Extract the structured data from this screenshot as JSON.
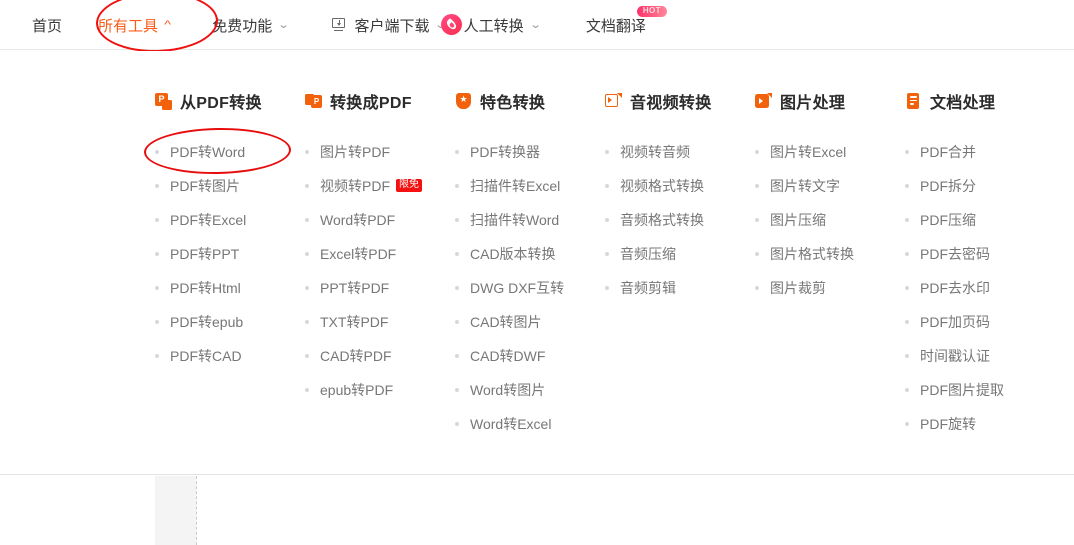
{
  "topnav": {
    "items": [
      {
        "label": "首页",
        "icon": null,
        "caret": null,
        "active": false,
        "badge": null
      },
      {
        "label": "所有工具",
        "icon": null,
        "caret": "^",
        "active": true,
        "badge": null
      },
      {
        "label": "免费功能",
        "icon": null,
        "caret": "⌄",
        "active": false,
        "badge": null
      },
      {
        "label": "客户端下载",
        "icon": "download-monitor-icon",
        "caret": "⌄",
        "active": false,
        "badge": null
      },
      {
        "label": "人工转换",
        "icon": "flame-icon",
        "caret": "⌄",
        "active": false,
        "badge": null
      },
      {
        "label": "文档翻译",
        "icon": null,
        "caret": null,
        "active": false,
        "badge": "HOT"
      }
    ]
  },
  "annotations": {
    "nav_highlight_target": "所有工具",
    "menu_highlight_target": "PDF转Word",
    "color": "#e80d0d",
    "shape": "ellipse"
  },
  "colors": {
    "accent": "#fa5d19",
    "icon_orange": "#f2610c",
    "badge_red": "#f51111",
    "menu_text": "#777777",
    "title_text": "#2b2b2b"
  },
  "mega_menu": {
    "columns": [
      {
        "title": "从PDF转换",
        "icon": "from-pdf-icon",
        "items": [
          {
            "label": "PDF转Word",
            "badge": null
          },
          {
            "label": "PDF转图片",
            "badge": null
          },
          {
            "label": "PDF转Excel",
            "badge": null
          },
          {
            "label": "PDF转PPT",
            "badge": null
          },
          {
            "label": "PDF转Html",
            "badge": null
          },
          {
            "label": "PDF转epub",
            "badge": null
          },
          {
            "label": "PDF转CAD",
            "badge": null
          }
        ]
      },
      {
        "title": "转换成PDF",
        "icon": "to-pdf-icon",
        "items": [
          {
            "label": "图片转PDF",
            "badge": null
          },
          {
            "label": "视频转PDF",
            "badge": "限免"
          },
          {
            "label": "Word转PDF",
            "badge": null
          },
          {
            "label": "Excel转PDF",
            "badge": null
          },
          {
            "label": "PPT转PDF",
            "badge": null
          },
          {
            "label": "TXT转PDF",
            "badge": null
          },
          {
            "label": "CAD转PDF",
            "badge": null
          },
          {
            "label": "epub转PDF",
            "badge": null
          }
        ]
      },
      {
        "title": "特色转换",
        "icon": "star-shield-icon",
        "items": [
          {
            "label": "PDF转换器",
            "badge": null
          },
          {
            "label": "扫描件转Excel",
            "badge": null
          },
          {
            "label": "扫描件转Word",
            "badge": null
          },
          {
            "label": "CAD版本转换",
            "badge": null
          },
          {
            "label": "DWG DXF互转",
            "badge": null
          },
          {
            "label": "CAD转图片",
            "badge": null
          },
          {
            "label": "CAD转DWF",
            "badge": null
          },
          {
            "label": "Word转图片",
            "badge": null
          },
          {
            "label": "Word转Excel",
            "badge": null
          }
        ]
      },
      {
        "title": "音视频转换",
        "icon": "media-icon",
        "items": [
          {
            "label": "视频转音频",
            "badge": null
          },
          {
            "label": "视频格式转换",
            "badge": null
          },
          {
            "label": "音频格式转换",
            "badge": null
          },
          {
            "label": "音频压缩",
            "badge": null
          },
          {
            "label": "音频剪辑",
            "badge": null
          }
        ]
      },
      {
        "title": "图片处理",
        "icon": "image-icon",
        "items": [
          {
            "label": "图片转Excel",
            "badge": null
          },
          {
            "label": "图片转文字",
            "badge": null
          },
          {
            "label": "图片压缩",
            "badge": null
          },
          {
            "label": "图片格式转换",
            "badge": null
          },
          {
            "label": "图片裁剪",
            "badge": null
          }
        ]
      },
      {
        "title": "文档处理",
        "icon": "document-icon",
        "items": [
          {
            "label": "PDF合并",
            "badge": null
          },
          {
            "label": "PDF拆分",
            "badge": null
          },
          {
            "label": "PDF压缩",
            "badge": null
          },
          {
            "label": "PDF去密码",
            "badge": null
          },
          {
            "label": "PDF去水印",
            "badge": null
          },
          {
            "label": "PDF加页码",
            "badge": null
          },
          {
            "label": "时间戳认证",
            "badge": null
          },
          {
            "label": "PDF图片提取",
            "badge": null
          },
          {
            "label": "PDF旋转",
            "badge": null
          }
        ]
      }
    ]
  }
}
